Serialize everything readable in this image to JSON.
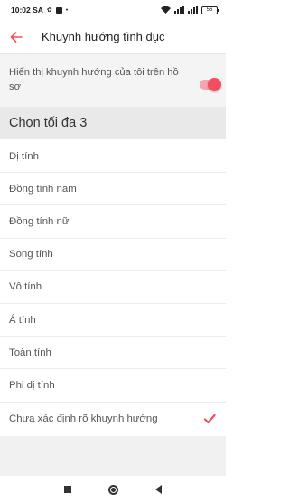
{
  "status_bar": {
    "time": "10:02 SA",
    "battery": "56"
  },
  "header": {
    "title": "Khuynh hướng tình dục"
  },
  "toggle": {
    "label": "Hiển thị khuynh hướng của tôi trên hồ sơ",
    "on": true
  },
  "section": {
    "title": "Chọn tối đa 3"
  },
  "options": [
    {
      "label": "Dị tính",
      "selected": false
    },
    {
      "label": "Đồng tính nam",
      "selected": false
    },
    {
      "label": "Đồng tính nữ",
      "selected": false
    },
    {
      "label": "Song tính",
      "selected": false
    },
    {
      "label": "Vô tính",
      "selected": false
    },
    {
      "label": "Á tính",
      "selected": false
    },
    {
      "label": "Toàn tính",
      "selected": false
    },
    {
      "label": "Phi dị tính",
      "selected": false
    },
    {
      "label": "Chưa xác định rõ khuynh hướng",
      "selected": true
    }
  ],
  "colors": {
    "accent": "#f24e5f"
  }
}
